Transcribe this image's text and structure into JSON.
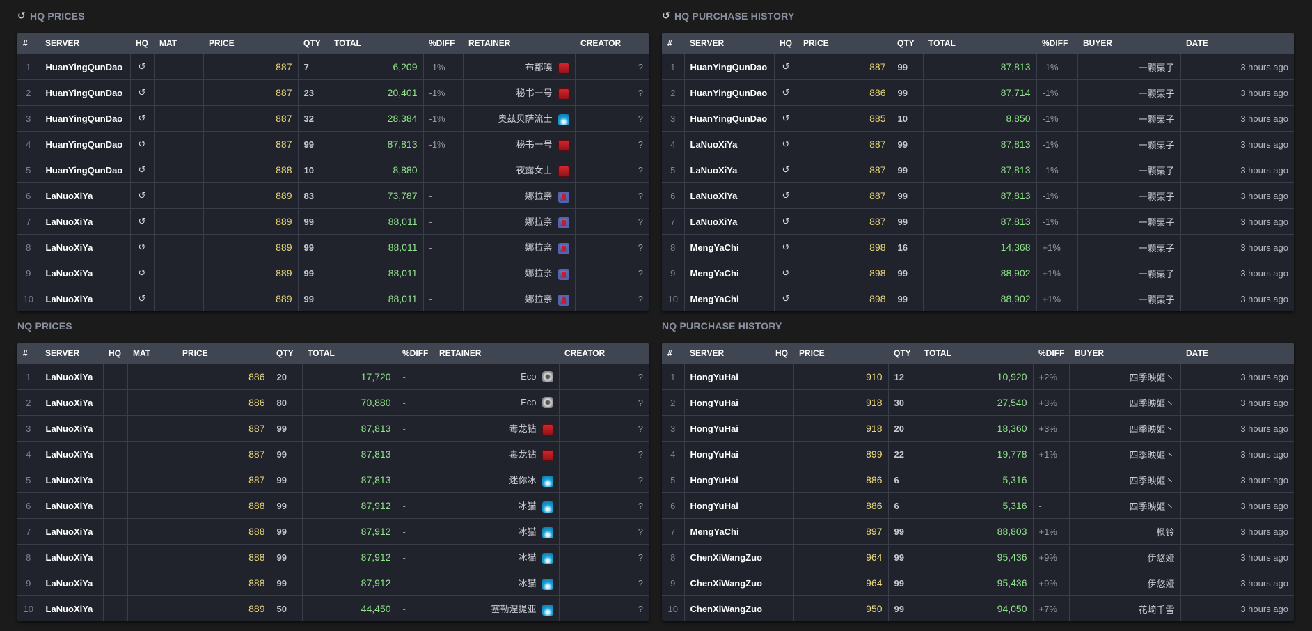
{
  "icons": {
    "hq": "hq-icon",
    "red": "marauder-class-icon",
    "blue": "white-mage-class-icon",
    "purple": "arcanist-class-icon",
    "gray": "gray-swirl-class-icon"
  },
  "colors": {
    "background": "#1b1b1c",
    "table": "#21232c",
    "header": "#404552",
    "price": "#e8d77a",
    "total": "#8fe38a"
  },
  "hq_prices": {
    "title": "HQ PRICES",
    "columns": [
      "#",
      "SERVER",
      "HQ",
      "MAT",
      "PRICE",
      "QTY",
      "TOTAL",
      "%DIFF",
      "RETAINER",
      "CREATOR"
    ],
    "rows": [
      {
        "n": "1",
        "server": "HuanYingQunDao",
        "hq": true,
        "price": "887",
        "qty": "7",
        "total": "6,209",
        "diff": "-1%",
        "retainer": "布都嘎",
        "icon": "red",
        "creator": "?"
      },
      {
        "n": "2",
        "server": "HuanYingQunDao",
        "hq": true,
        "price": "887",
        "qty": "23",
        "total": "20,401",
        "diff": "-1%",
        "retainer": "秘书一号",
        "icon": "red",
        "creator": "?"
      },
      {
        "n": "3",
        "server": "HuanYingQunDao",
        "hq": true,
        "price": "887",
        "qty": "32",
        "total": "28,384",
        "diff": "-1%",
        "retainer": "奥兹贝萨流士",
        "icon": "blue",
        "creator": "?"
      },
      {
        "n": "4",
        "server": "HuanYingQunDao",
        "hq": true,
        "price": "887",
        "qty": "99",
        "total": "87,813",
        "diff": "-1%",
        "retainer": "秘书一号",
        "icon": "red",
        "creator": "?"
      },
      {
        "n": "5",
        "server": "HuanYingQunDao",
        "hq": true,
        "price": "888",
        "qty": "10",
        "total": "8,880",
        "diff": "-",
        "retainer": "夜露女士",
        "icon": "red",
        "creator": "?"
      },
      {
        "n": "6",
        "server": "LaNuoXiYa",
        "hq": true,
        "price": "889",
        "qty": "83",
        "total": "73,787",
        "diff": "-",
        "retainer": "娜拉亲",
        "icon": "purple",
        "creator": "?"
      },
      {
        "n": "7",
        "server": "LaNuoXiYa",
        "hq": true,
        "price": "889",
        "qty": "99",
        "total": "88,011",
        "diff": "-",
        "retainer": "娜拉亲",
        "icon": "purple",
        "creator": "?"
      },
      {
        "n": "8",
        "server": "LaNuoXiYa",
        "hq": true,
        "price": "889",
        "qty": "99",
        "total": "88,011",
        "diff": "-",
        "retainer": "娜拉亲",
        "icon": "purple",
        "creator": "?"
      },
      {
        "n": "9",
        "server": "LaNuoXiYa",
        "hq": true,
        "price": "889",
        "qty": "99",
        "total": "88,011",
        "diff": "-",
        "retainer": "娜拉亲",
        "icon": "purple",
        "creator": "?"
      },
      {
        "n": "10",
        "server": "LaNuoXiYa",
        "hq": true,
        "price": "889",
        "qty": "99",
        "total": "88,011",
        "diff": "-",
        "retainer": "娜拉亲",
        "icon": "purple",
        "creator": "?"
      }
    ]
  },
  "hq_history": {
    "title": "HQ PURCHASE HISTORY",
    "columns": [
      "#",
      "SERVER",
      "HQ",
      "PRICE",
      "QTY",
      "TOTAL",
      "%DIFF",
      "BUYER",
      "DATE"
    ],
    "rows": [
      {
        "n": "1",
        "server": "HuanYingQunDao",
        "hq": true,
        "price": "887",
        "qty": "99",
        "total": "87,813",
        "diff": "-1%",
        "buyer": "一颗栗子",
        "date": "3 hours ago"
      },
      {
        "n": "2",
        "server": "HuanYingQunDao",
        "hq": true,
        "price": "886",
        "qty": "99",
        "total": "87,714",
        "diff": "-1%",
        "buyer": "一颗栗子",
        "date": "3 hours ago"
      },
      {
        "n": "3",
        "server": "HuanYingQunDao",
        "hq": true,
        "price": "885",
        "qty": "10",
        "total": "8,850",
        "diff": "-1%",
        "buyer": "一颗栗子",
        "date": "3 hours ago"
      },
      {
        "n": "4",
        "server": "LaNuoXiYa",
        "hq": true,
        "price": "887",
        "qty": "99",
        "total": "87,813",
        "diff": "-1%",
        "buyer": "一颗栗子",
        "date": "3 hours ago"
      },
      {
        "n": "5",
        "server": "LaNuoXiYa",
        "hq": true,
        "price": "887",
        "qty": "99",
        "total": "87,813",
        "diff": "-1%",
        "buyer": "一颗栗子",
        "date": "3 hours ago"
      },
      {
        "n": "6",
        "server": "LaNuoXiYa",
        "hq": true,
        "price": "887",
        "qty": "99",
        "total": "87,813",
        "diff": "-1%",
        "buyer": "一颗栗子",
        "date": "3 hours ago"
      },
      {
        "n": "7",
        "server": "LaNuoXiYa",
        "hq": true,
        "price": "887",
        "qty": "99",
        "total": "87,813",
        "diff": "-1%",
        "buyer": "一颗栗子",
        "date": "3 hours ago"
      },
      {
        "n": "8",
        "server": "MengYaChi",
        "hq": true,
        "price": "898",
        "qty": "16",
        "total": "14,368",
        "diff": "+1%",
        "buyer": "一颗栗子",
        "date": "3 hours ago"
      },
      {
        "n": "9",
        "server": "MengYaChi",
        "hq": true,
        "price": "898",
        "qty": "99",
        "total": "88,902",
        "diff": "+1%",
        "buyer": "一颗栗子",
        "date": "3 hours ago"
      },
      {
        "n": "10",
        "server": "MengYaChi",
        "hq": true,
        "price": "898",
        "qty": "99",
        "total": "88,902",
        "diff": "+1%",
        "buyer": "一颗栗子",
        "date": "3 hours ago"
      }
    ]
  },
  "nq_prices": {
    "title": "NQ PRICES",
    "columns": [
      "#",
      "SERVER",
      "HQ",
      "MAT",
      "PRICE",
      "QTY",
      "TOTAL",
      "%DIFF",
      "RETAINER",
      "CREATOR"
    ],
    "rows": [
      {
        "n": "1",
        "server": "LaNuoXiYa",
        "hq": false,
        "price": "886",
        "qty": "20",
        "total": "17,720",
        "diff": "-",
        "retainer": "Eco",
        "icon": "gray",
        "creator": "?"
      },
      {
        "n": "2",
        "server": "LaNuoXiYa",
        "hq": false,
        "price": "886",
        "qty": "80",
        "total": "70,880",
        "diff": "-",
        "retainer": "Eco",
        "icon": "gray",
        "creator": "?"
      },
      {
        "n": "3",
        "server": "LaNuoXiYa",
        "hq": false,
        "price": "887",
        "qty": "99",
        "total": "87,813",
        "diff": "-",
        "retainer": "毒龙钻",
        "icon": "red",
        "creator": "?"
      },
      {
        "n": "4",
        "server": "LaNuoXiYa",
        "hq": false,
        "price": "887",
        "qty": "99",
        "total": "87,813",
        "diff": "-",
        "retainer": "毒龙钻",
        "icon": "red",
        "creator": "?"
      },
      {
        "n": "5",
        "server": "LaNuoXiYa",
        "hq": false,
        "price": "887",
        "qty": "99",
        "total": "87,813",
        "diff": "-",
        "retainer": "迷你冰",
        "icon": "blue",
        "creator": "?"
      },
      {
        "n": "6",
        "server": "LaNuoXiYa",
        "hq": false,
        "price": "888",
        "qty": "99",
        "total": "87,912",
        "diff": "-",
        "retainer": "冰猫",
        "icon": "blue",
        "creator": "?"
      },
      {
        "n": "7",
        "server": "LaNuoXiYa",
        "hq": false,
        "price": "888",
        "qty": "99",
        "total": "87,912",
        "diff": "-",
        "retainer": "冰猫",
        "icon": "blue",
        "creator": "?"
      },
      {
        "n": "8",
        "server": "LaNuoXiYa",
        "hq": false,
        "price": "888",
        "qty": "99",
        "total": "87,912",
        "diff": "-",
        "retainer": "冰猫",
        "icon": "blue",
        "creator": "?"
      },
      {
        "n": "9",
        "server": "LaNuoXiYa",
        "hq": false,
        "price": "888",
        "qty": "99",
        "total": "87,912",
        "diff": "-",
        "retainer": "冰猫",
        "icon": "blue",
        "creator": "?"
      },
      {
        "n": "10",
        "server": "LaNuoXiYa",
        "hq": false,
        "price": "889",
        "qty": "50",
        "total": "44,450",
        "diff": "-",
        "retainer": "塞勒涅提亚",
        "icon": "blue",
        "creator": "?"
      }
    ]
  },
  "nq_history": {
    "title": "NQ PURCHASE HISTORY",
    "columns": [
      "#",
      "SERVER",
      "HQ",
      "PRICE",
      "QTY",
      "TOTAL",
      "%DIFF",
      "BUYER",
      "DATE"
    ],
    "rows": [
      {
        "n": "1",
        "server": "HongYuHai",
        "hq": false,
        "price": "910",
        "qty": "12",
        "total": "10,920",
        "diff": "+2%",
        "buyer": "四季映姬丶",
        "date": "3 hours ago"
      },
      {
        "n": "2",
        "server": "HongYuHai",
        "hq": false,
        "price": "918",
        "qty": "30",
        "total": "27,540",
        "diff": "+3%",
        "buyer": "四季映姬丶",
        "date": "3 hours ago"
      },
      {
        "n": "3",
        "server": "HongYuHai",
        "hq": false,
        "price": "918",
        "qty": "20",
        "total": "18,360",
        "diff": "+3%",
        "buyer": "四季映姬丶",
        "date": "3 hours ago"
      },
      {
        "n": "4",
        "server": "HongYuHai",
        "hq": false,
        "price": "899",
        "qty": "22",
        "total": "19,778",
        "diff": "+1%",
        "buyer": "四季映姬丶",
        "date": "3 hours ago"
      },
      {
        "n": "5",
        "server": "HongYuHai",
        "hq": false,
        "price": "886",
        "qty": "6",
        "total": "5,316",
        "diff": "-",
        "buyer": "四季映姬丶",
        "date": "3 hours ago"
      },
      {
        "n": "6",
        "server": "HongYuHai",
        "hq": false,
        "price": "886",
        "qty": "6",
        "total": "5,316",
        "diff": "-",
        "buyer": "四季映姬丶",
        "date": "3 hours ago"
      },
      {
        "n": "7",
        "server": "MengYaChi",
        "hq": false,
        "price": "897",
        "qty": "99",
        "total": "88,803",
        "diff": "+1%",
        "buyer": "枫铃",
        "date": "3 hours ago"
      },
      {
        "n": "8",
        "server": "ChenXiWangZuo",
        "hq": false,
        "price": "964",
        "qty": "99",
        "total": "95,436",
        "diff": "+9%",
        "buyer": "伊悠娅",
        "date": "3 hours ago"
      },
      {
        "n": "9",
        "server": "ChenXiWangZuo",
        "hq": false,
        "price": "964",
        "qty": "99",
        "total": "95,436",
        "diff": "+9%",
        "buyer": "伊悠娅",
        "date": "3 hours ago"
      },
      {
        "n": "10",
        "server": "ChenXiWangZuo",
        "hq": false,
        "price": "950",
        "qty": "99",
        "total": "94,050",
        "diff": "+7%",
        "buyer": "花崎千雪",
        "date": "3 hours ago"
      }
    ]
  }
}
